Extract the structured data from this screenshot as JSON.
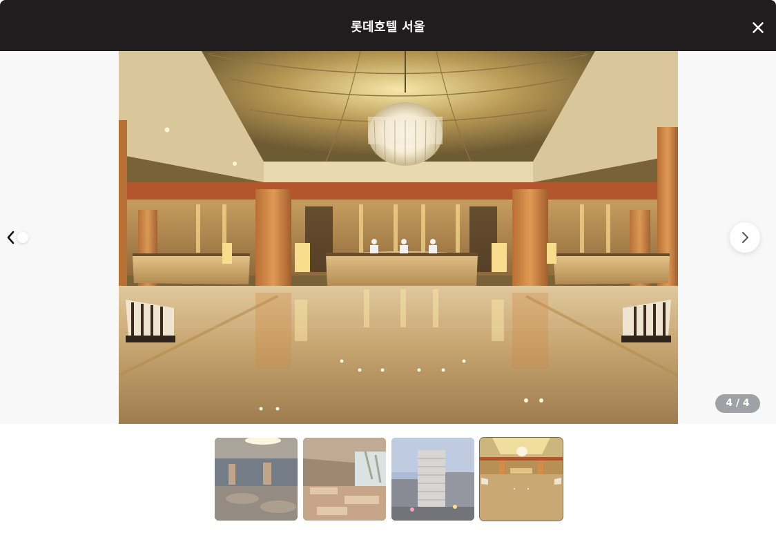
{
  "header": {
    "title": "롯데호텔 서울",
    "close_icon": "close-icon"
  },
  "viewer": {
    "counter": "4 / 4",
    "current_index": 4,
    "total": 4,
    "prev_icon": "chevron-left-icon",
    "next_icon": "chevron-right-icon"
  },
  "thumbnails": [
    {
      "name": "thumbnail-restaurant-dining",
      "active": false
    },
    {
      "name": "thumbnail-cafe-terrace",
      "active": false
    },
    {
      "name": "thumbnail-hotel-exterior",
      "active": false
    },
    {
      "name": "thumbnail-lobby",
      "active": true
    }
  ],
  "colors": {
    "header_bg": "#211d1e",
    "stage_bg": "#f8f8f8",
    "counter_bg": "#9fa1a6"
  }
}
